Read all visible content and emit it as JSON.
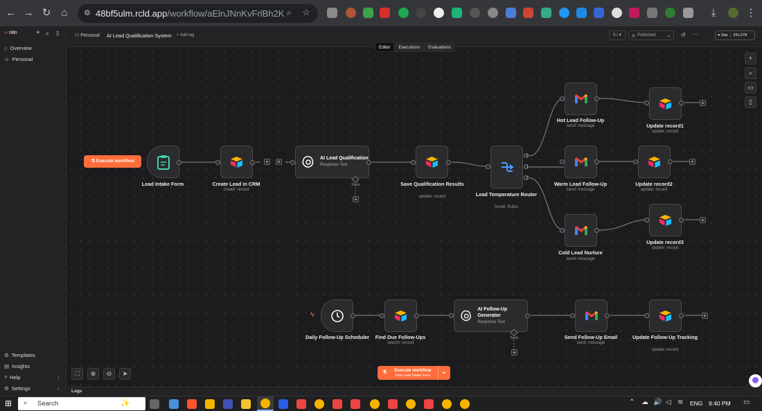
{
  "browser": {
    "url_host": "48bf5ulm.rcld.app",
    "url_path": "/workflow/aElnJNnKvFrlBh2K"
  },
  "sidebar": {
    "brand": "n8n",
    "items": [
      {
        "label": "Overview",
        "icon": "home-icon"
      },
      {
        "label": "Personal",
        "icon": "user-icon"
      }
    ],
    "bottom_items": [
      {
        "label": "Templates",
        "icon": "templates-icon"
      },
      {
        "label": "Insights",
        "icon": "insights-icon"
      },
      {
        "label": "Help",
        "icon": "help-icon"
      },
      {
        "label": "Settings",
        "icon": "settings-icon"
      }
    ]
  },
  "header": {
    "breadcrumb_project": "Personal",
    "workflow_name": "AI Lead Qualification System",
    "add_tag": "+ Add tag",
    "counter": "0 / 4",
    "published": "Published",
    "star_label": "Star",
    "star_count": "291,078",
    "more": "···"
  },
  "tabs": [
    "Editor",
    "Executions",
    "Evaluations"
  ],
  "active_tab": "Editor",
  "execute_button": "Execute workflow",
  "bottom_execute": {
    "label": "Execute workflow",
    "sub": "from Lead Intake Form"
  },
  "logs_label": "Logs",
  "nodes": {
    "lead_intake": {
      "title": "Lead Intake Form"
    },
    "create_crm": {
      "title": "Create Lead in CRM",
      "sub": "create: record"
    },
    "ai_qual": {
      "title": "AI Lead Qualification",
      "sub": "Response Text",
      "tools": "Tools"
    },
    "save_qual": {
      "title": "Save Qualification Results",
      "sub": "update: record"
    },
    "router": {
      "title": "Lead Temperature Router",
      "sub": "mode: Rules",
      "outputs": [
        "0",
        "1",
        "2"
      ]
    },
    "hot": {
      "title": "Hot Lead Follow-Up",
      "sub": "send: message"
    },
    "warm": {
      "title": "Warm Lead Follow-Up",
      "sub": "send: message"
    },
    "cold": {
      "title": "Cold Lead Nurture",
      "sub": "send: message"
    },
    "upd1": {
      "title": "Update record1",
      "sub": "update: record"
    },
    "upd2": {
      "title": "Update record2",
      "sub": "update: record"
    },
    "upd3": {
      "title": "Update record3",
      "sub": "update: record"
    },
    "daily": {
      "title": "Daily Follow-Up Scheduler"
    },
    "find_due": {
      "title": "Find Due Follow-Ups",
      "sub": "search: record"
    },
    "ai_followup": {
      "title": "AI Follow-Up Generator",
      "sub": "Response Text",
      "tools": "Tools"
    },
    "send_email": {
      "title": "Send Follow-Up Email",
      "sub": "send: message"
    },
    "upd_tracking": {
      "title": "Update Follow-Up Tracking",
      "sub": "update: record"
    }
  },
  "taskbar": {
    "search": "Search",
    "lang": "ENG",
    "time": "9:40 PM"
  },
  "colors": {
    "accent": "#ff6d3b",
    "gmail_red": "#ea4335",
    "airtable_yellow": "#fcb400",
    "router_blue": "#4a9eff"
  }
}
